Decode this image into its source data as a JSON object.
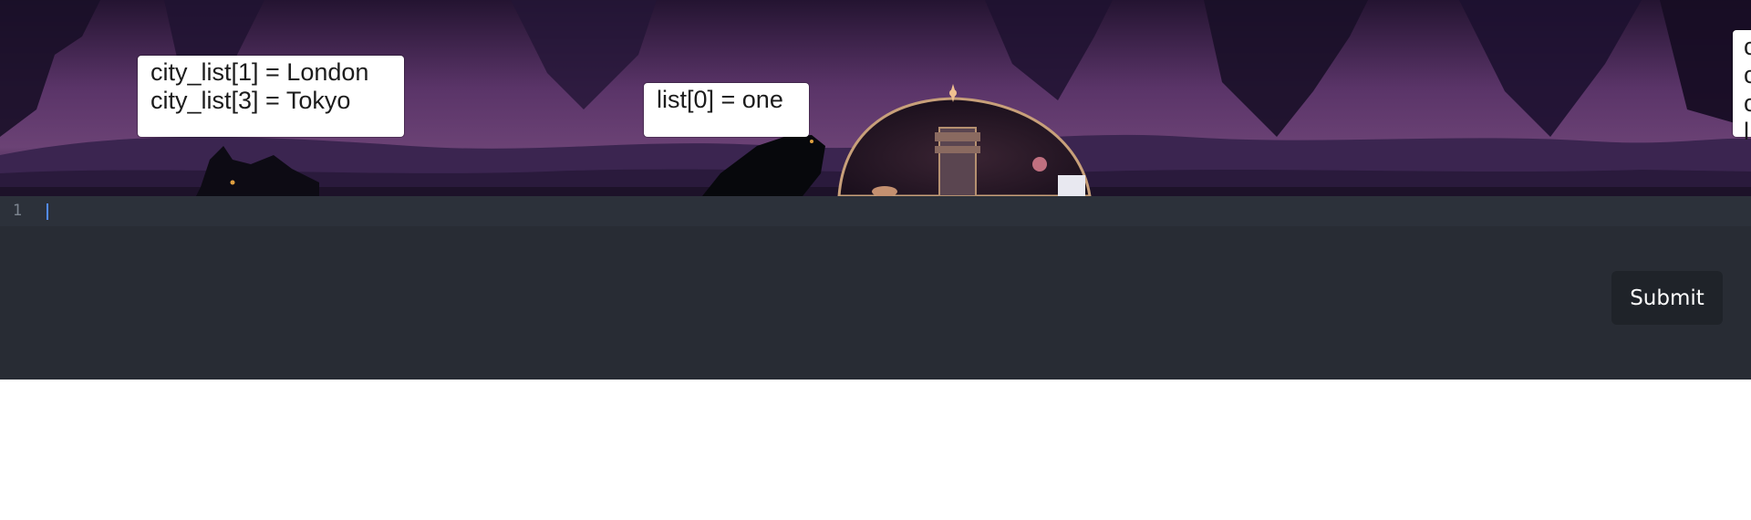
{
  "scene": {
    "bubbles": [
      {
        "lines": [
          "city_list[1] = London",
          "city_list[3] = Tokyo"
        ]
      },
      {
        "lines": [
          "list[0] = one"
        ]
      },
      {
        "lines": [
          "c",
          "c",
          "c",
          "l"
        ]
      }
    ]
  },
  "editor": {
    "line_number": "1",
    "code_value": "",
    "code_placeholder": ""
  },
  "actions": {
    "submit_label": "Submit"
  },
  "colors": {
    "editor_bg": "#282c34",
    "active_line_bg": "#2c313a",
    "cursor": "#528bff",
    "submit_bg": "#1f2329"
  }
}
